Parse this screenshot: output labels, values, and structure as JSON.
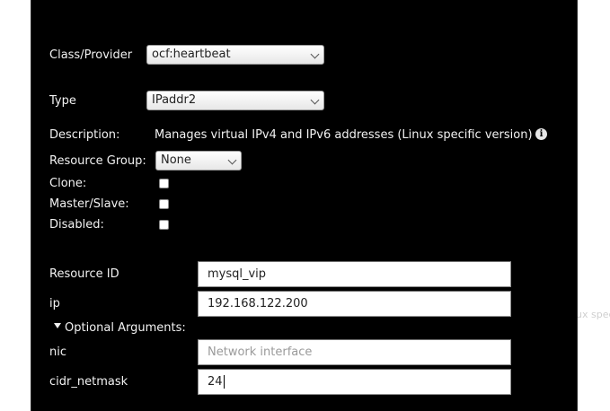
{
  "background": {
    "overflow_text": "ux spec"
  },
  "form": {
    "class_provider": {
      "label": "Class/Provider",
      "value": "ocf:heartbeat"
    },
    "type": {
      "label": "Type",
      "value": "IPaddr2"
    },
    "description": {
      "label": "Description:",
      "value": "Manages virtual IPv4 and IPv6 addresses (Linux specific version)"
    },
    "resource_group": {
      "label": "Resource Group:",
      "value": "None"
    },
    "clone": {
      "label": "Clone:",
      "checked": false
    },
    "master_slave": {
      "label": "Master/Slave:",
      "checked": false
    },
    "disabled": {
      "label": "Disabled:",
      "checked": false
    },
    "resource_id": {
      "label": "Resource ID",
      "value": "mysql_vip"
    },
    "ip": {
      "label": "ip",
      "value": "192.168.122.200"
    },
    "optional_arguments": {
      "label": "Optional Arguments:",
      "expanded": true
    },
    "nic": {
      "label": "nic",
      "value": "",
      "placeholder": "Network interface"
    },
    "cidr_netmask": {
      "label": "cidr_netmask",
      "value": "24"
    }
  },
  "colors": {
    "dialog_bg": "#000000",
    "text": "#f2f2f2",
    "input_bg": "#ffffff"
  }
}
